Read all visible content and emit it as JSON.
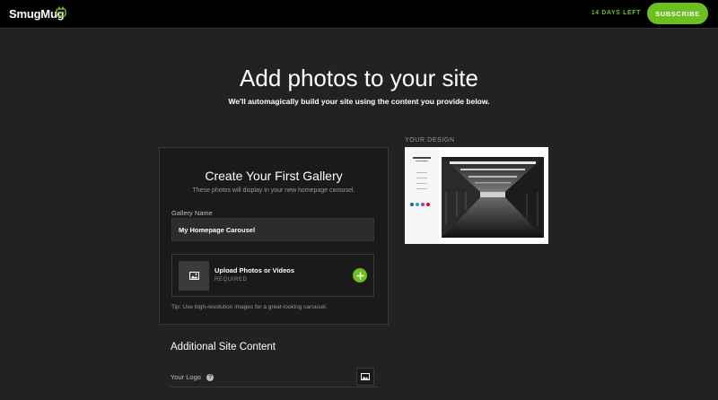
{
  "header": {
    "logo_text": "SmugMug",
    "trial_text": "14 DAYS LEFT",
    "subscribe_label": "SUBSCRIBE",
    "accent_color": "#6dbe1f"
  },
  "hero": {
    "title": "Add photos to your site",
    "subtitle": "We'll automagically build your site using the content you provide below."
  },
  "gallery_card": {
    "title": "Create Your First Gallery",
    "subtitle": "These photos will display in your new homepage carousel.",
    "gallery_name_label": "Gallery Name",
    "gallery_name_value": "My Homepage Carousel",
    "upload_title": "Upload Photos or Videos",
    "upload_required": "REQUIRED",
    "tip": "Tip: Use high-resolution images for a great-looking carousel."
  },
  "design": {
    "label": "YOUR DESIGN"
  },
  "additional": {
    "title": "Additional Site Content",
    "logo_label": "Your Logo"
  },
  "icons": {
    "logo_face": "smile-icon",
    "upload_thumb": "image-icon",
    "add": "plus-icon",
    "help": "question-icon",
    "logo_upload": "image-icon"
  }
}
